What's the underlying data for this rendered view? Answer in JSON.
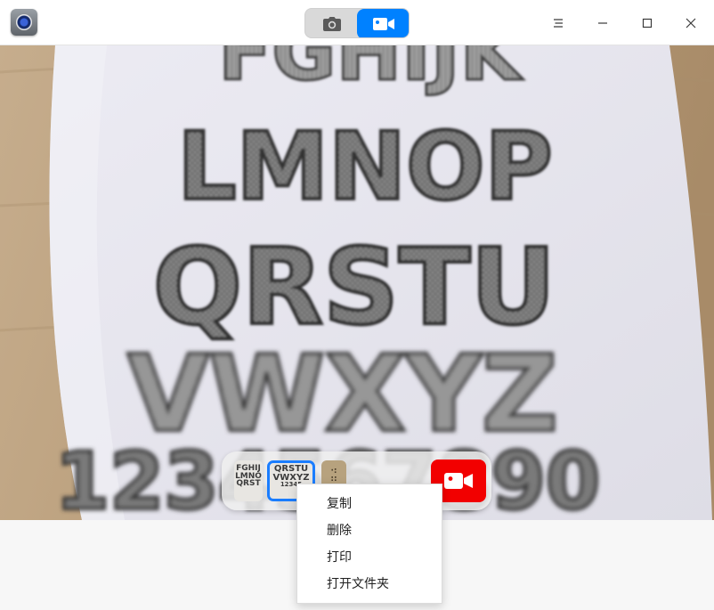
{
  "titlebar": {
    "app_icon": "camera-app-icon",
    "modes": [
      {
        "name": "photo",
        "icon": "camera-icon",
        "active": false
      },
      {
        "name": "video",
        "icon": "video-icon",
        "active": true
      }
    ],
    "window_controls": [
      "menu-icon",
      "minimize-icon",
      "maximize-icon",
      "close-icon"
    ],
    "accent_color": "#0081ff"
  },
  "viewport": {
    "paper_lines": [
      "FGHIJK",
      "LMNOP",
      "QRSTU",
      "VWXYZ",
      "1234567890"
    ]
  },
  "thumbnails": {
    "items": [
      {
        "lines": [
          "FGHIJ",
          "LMNO",
          "QRST"
        ]
      },
      {
        "lines": [
          "QRSTU",
          "VWXYZ",
          "12345"
        ],
        "selected": true
      },
      {
        "lines": [
          "·:",
          "::"
        ]
      }
    ],
    "record_button_icon": "video-record-icon",
    "record_color": "#f20000"
  },
  "context_menu": {
    "items": [
      "复制",
      "删除",
      "打印",
      "打开文件夹"
    ]
  }
}
